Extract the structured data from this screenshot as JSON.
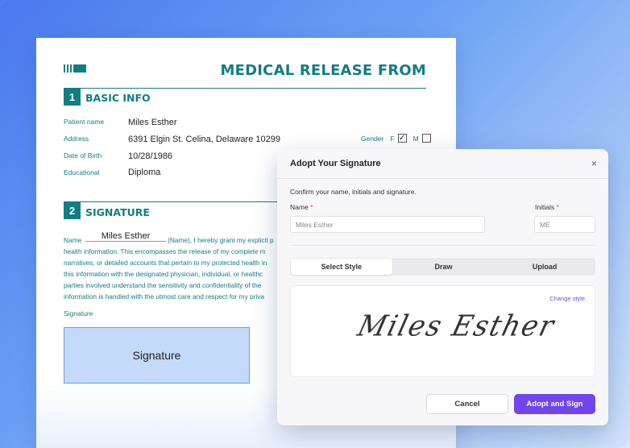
{
  "document": {
    "title": "MEDICAL RELEASE FROM",
    "section1": {
      "number": "1",
      "title": "BASIC INFO"
    },
    "fields": [
      {
        "label": "Patient name",
        "value": "Miles Esther"
      },
      {
        "label": "Address",
        "value": "6391 Elgin St. Celina, Delaware 10299"
      },
      {
        "label": "Date of Birth",
        "value": "10/28/1986"
      },
      {
        "label": "Educational",
        "value": "Diploma"
      }
    ],
    "gender": {
      "label": "Gender",
      "female": "F",
      "male": "M",
      "female_mark": "✓"
    },
    "section2": {
      "number": "2",
      "title": "SIGNATURE"
    },
    "consent": {
      "name_label": "Name",
      "name_value": "Miles Esther",
      "line1_rest": "(Name), I hereby grant my explicit p",
      "lines": [
        "health information. This encompasses the release of my complete m",
        "narratives, or detailed accounts that pertain to my protected health in",
        "this information with the designated physician, individual, or healthc",
        "parties involved understand the sensitivity and confidentiality of the",
        "information is handled with the utmost care and respect for my priva"
      ]
    },
    "signature_label": "Signature",
    "signature_box_text": "Signature"
  },
  "modal": {
    "title": "Adopt Your Signature",
    "close_icon": "×",
    "subtitle": "Confirm your name, initials and signature.",
    "name_label": "Name",
    "name_value": "Miles Esther",
    "initials_label": "Initials",
    "initials_value": "ME",
    "required_mark": "*",
    "tabs": [
      "Select Style",
      "Draw",
      "Upload"
    ],
    "active_tab": "Select Style",
    "change_style": "Change style",
    "signature_preview": "Miles Esther",
    "cancel_label": "Cancel",
    "adopt_label": "Adopt and Sign"
  },
  "colors": {
    "teal": "#127d82",
    "accent": "#7045ec",
    "signature_fill": "#c3dafa"
  }
}
